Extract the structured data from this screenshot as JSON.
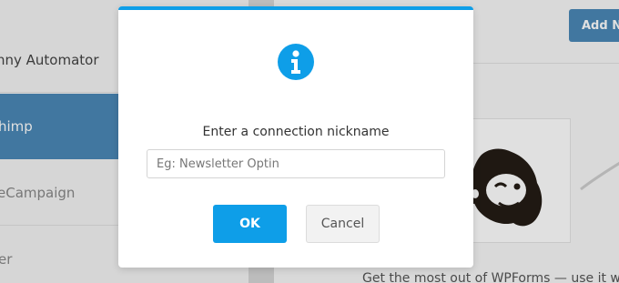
{
  "background": {
    "sidebar": {
      "items": [
        {
          "label": "nny Automator",
          "state": "normal"
        },
        {
          "label": "himp",
          "state": "active"
        },
        {
          "label": "eCampaign",
          "state": "muted"
        },
        {
          "label": "er",
          "state": "muted"
        }
      ]
    },
    "header": {
      "add_button_label": "Add N"
    },
    "body_text": "Get the most out of WPForms — use it with"
  },
  "dialog": {
    "icon": "info-icon",
    "prompt": "Enter a connection nickname",
    "input": {
      "value": "",
      "placeholder": "Eg: Newsletter Optin"
    },
    "ok_label": "OK",
    "cancel_label": "Cancel"
  },
  "colors": {
    "accent": "#0e9ee8",
    "sidebar_active": "#4a88b7",
    "add_button": "#4a88b7"
  }
}
